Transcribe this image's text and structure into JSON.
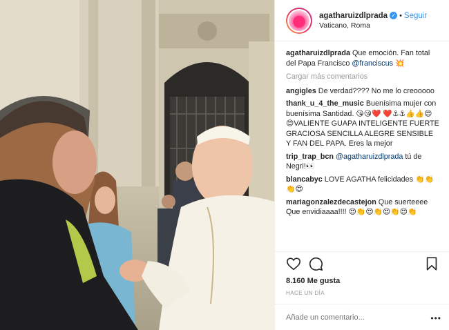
{
  "header": {
    "username": "agatharuizdlprada",
    "verified_mark": "✓",
    "separator": "•",
    "follow_label": "Seguir",
    "location": "Vaticano, Roma"
  },
  "caption": {
    "username": "agatharuizdlprada",
    "text": " Que emoción. Fan total del Papa Francisco ",
    "mention": "@franciscus",
    "emoji": " 💥"
  },
  "load_more_label": "Cargar más comentarios",
  "comments": [
    {
      "user": "angigles",
      "text": " De verdad???? No me lo creooooo"
    },
    {
      "user": "thank_u_4_the_music",
      "text": " Buenísima mujer con buenísima Santidad. 😘😘❤️ ❤️⚓⚓👍👍😍😍VALIENTE GUAPA INTELIGENTE FUERTE GRACIOSA SENCILLA ALEGRE SENSIBLE Y FAN DEL PAPA. Eres la mejor"
    },
    {
      "user": "trip_trap_bcn",
      "mention": " @agatharuizdlprada",
      "text": " tú de Negri!👀"
    },
    {
      "user": "blancabyc",
      "text": " LOVE AGATHA felicidades 👏👏👏😍"
    },
    {
      "user": "mariagonzalezdecastejon",
      "text": " Que suerteeee Que envidiaaaa!!!! 😍👏😍👏😍👏😍👏"
    }
  ],
  "likes": "8.160 Me gusta",
  "timestamp": "HACE UN DÍA",
  "add_comment_placeholder": "Añade un comentario...",
  "options_label": "•••",
  "icons": [
    "heart-icon",
    "comment-icon",
    "bookmark-icon",
    "verified-badge-icon",
    "avatar"
  ]
}
